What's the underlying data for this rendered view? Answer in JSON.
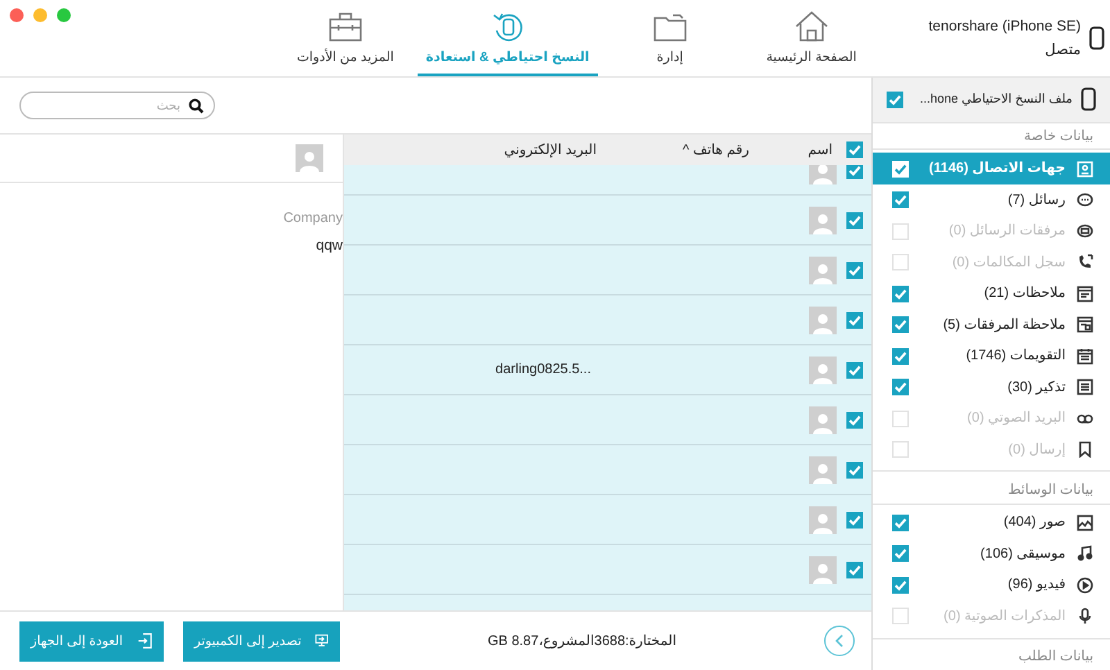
{
  "nav": {
    "tabs": [
      {
        "label": "الصفحة الرئيسية",
        "selected": false
      },
      {
        "label": "إدارة",
        "selected": false
      },
      {
        "label": "النسخ احتياطي & استعادة",
        "selected": true
      },
      {
        "label": "المزيد من الأدوات",
        "selected": false
      }
    ]
  },
  "device": {
    "name": "tenorshare (iPhone SE)",
    "status": "متصل"
  },
  "backup_file": {
    "label": "ملف النسخ الاحتياطي hone...",
    "checked": true
  },
  "sidebar": {
    "sections": [
      {
        "title": "بيانات خاصة",
        "items": [
          {
            "label": "جهات الاتصال (1146)",
            "checked": true,
            "disabled": false,
            "selected": true
          },
          {
            "label": "رسائل (7)",
            "checked": true,
            "disabled": false,
            "selected": false
          },
          {
            "label": "مرفقات الرسائل (0)",
            "checked": false,
            "disabled": true,
            "selected": false
          },
          {
            "label": "سجل المكالمات (0)",
            "checked": false,
            "disabled": true,
            "selected": false
          },
          {
            "label": "ملاحظات (21)",
            "checked": true,
            "disabled": false,
            "selected": false
          },
          {
            "label": "ملاحظة المرفقات (5)",
            "checked": true,
            "disabled": false,
            "selected": false
          },
          {
            "label": "التقويمات (1746)",
            "checked": true,
            "disabled": false,
            "selected": false
          },
          {
            "label": "تذكير (30)",
            "checked": true,
            "disabled": false,
            "selected": false
          },
          {
            "label": "البريد الصوتي (0)",
            "checked": false,
            "disabled": true,
            "selected": false
          },
          {
            "label": "إرسال (0)",
            "checked": false,
            "disabled": true,
            "selected": false
          }
        ]
      },
      {
        "title": "بيانات الوسائط",
        "items": [
          {
            "label": "صور (404)",
            "checked": true,
            "disabled": false,
            "selected": false
          },
          {
            "label": "موسيقى (106)",
            "checked": true,
            "disabled": false,
            "selected": false
          },
          {
            "label": "فيديو (96)",
            "checked": true,
            "disabled": false,
            "selected": false
          },
          {
            "label": "المذكرات الصوتية (0)",
            "checked": false,
            "disabled": true,
            "selected": false
          }
        ]
      },
      {
        "title": "بيانات الطلب"
      }
    ]
  },
  "search": {
    "placeholder": "بحث"
  },
  "table": {
    "select_all": true,
    "columns": [
      "اسم",
      "رقم هاتف",
      "البريد الإلكتروني"
    ],
    "sort_indicator": "^",
    "rows": [
      {
        "checked": true
      },
      {
        "checked": true
      },
      {
        "checked": true
      },
      {
        "checked": true
      },
      {
        "checked": true,
        "email": "darling0825.5..."
      },
      {
        "checked": true
      },
      {
        "checked": true
      },
      {
        "checked": true
      },
      {
        "checked": true
      }
    ]
  },
  "detail": {
    "field_label": "Company",
    "field_value": "qqw"
  },
  "footer": {
    "summary": "المختارة:3688المشروع،8.87 GB",
    "buttons": [
      "تصدير إلى الكمبيوتر",
      "العودة إلى الجهاز"
    ]
  }
}
